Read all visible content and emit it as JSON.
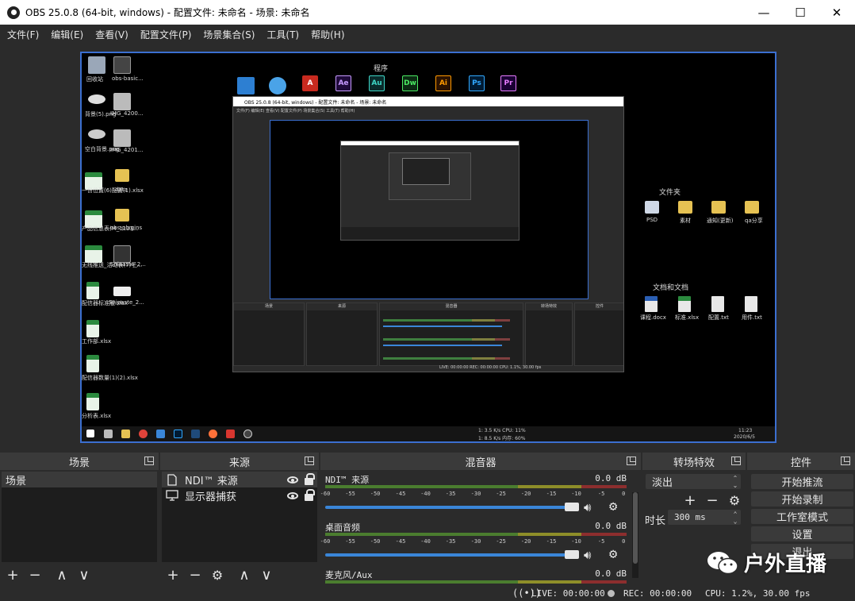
{
  "window": {
    "title": "OBS 25.0.8 (64-bit, windows) - 配置文件: 未命名 - 场景: 未命名",
    "minimize": "—",
    "maximize": "☐",
    "close": "✕"
  },
  "menu": [
    "文件(F)",
    "编辑(E)",
    "查看(V)",
    "配置文件(P)",
    "场景集合(S)",
    "工具(T)",
    "帮助(H)"
  ],
  "preview": {
    "desktop_header_programs": "程序",
    "desktop_header_folders": "文件夹",
    "desktop_header_docs": "文档和文档",
    "app_tiles": [
      "Ae",
      "Au",
      "Dw",
      "Ai",
      "Ps",
      "Pr"
    ],
    "left_icons": [
      "回收站",
      "obs-basic...",
      "背景(5).png",
      "IMG_4200...",
      "空白背景.png",
      "IMG_4201...",
      "一份位置(6)配置(1).xlsx",
      "data",
      "产品信息表(M_1123...",
      "obs-plugins",
      "无线推送_活动表(7)子...",
      "Snipaste_2...",
      "配信器标准版.xlsx",
      "Snipaste_2...",
      "工作部.xlsx",
      "配信器数量(1)(2).xlsx",
      "分析表.xlsx"
    ],
    "folder_labels": [
      "PSD",
      "素材",
      "通知(更新)",
      "qa分享"
    ],
    "doc_labels": [
      "课程.docx",
      "标准.xlsx",
      "配置.txt",
      "用件.txt"
    ],
    "nested_title": "OBS 25.0.8 (64-bit, windows) - 配置文件: 未命名 - 场景: 未命名",
    "nested_status": "LIVE: 00:00:00   REC: 00:00:00   CPU: 1.1%, 30.00 fps",
    "taskbar_clock": "11:23",
    "taskbar_date": "2020/6/5",
    "taskbar_net": "1: 3.5 K/s  CPU: 11%",
    "taskbar_net2": "1: 8.5 K/s  内存: 60%"
  },
  "scenes": {
    "header": "场景",
    "items": [
      "场景"
    ]
  },
  "sources": {
    "header": "来源",
    "items": [
      {
        "name": "NDI™ 来源",
        "icon": "file-icon"
      },
      {
        "name": "显示器捕获",
        "icon": "monitor-icon"
      }
    ]
  },
  "mixer": {
    "header": "混音器",
    "ticks": [
      "-60",
      "-55",
      "-50",
      "-45",
      "-40",
      "-35",
      "-30",
      "-25",
      "-20",
      "-15",
      "-10",
      "-5",
      "0"
    ],
    "channels": [
      {
        "name": "NDI™ 来源",
        "db": "0.0 dB",
        "volume": 1.0
      },
      {
        "name": "桌面音频",
        "db": "0.0 dB",
        "volume": 1.0
      },
      {
        "name": "麦克风/Aux",
        "db": "0.0 dB",
        "volume": 1.0
      }
    ]
  },
  "transitions": {
    "header": "转场特效",
    "selected": "淡出",
    "duration_label": "时长",
    "duration_value": "300 ms"
  },
  "controls": {
    "header": "控件",
    "buttons": [
      "开始推流",
      "开始录制",
      "工作室模式",
      "设置",
      "退出"
    ]
  },
  "status": {
    "live": "LIVE: 00:00:00",
    "rec": "REC: 00:00:00",
    "cpu": "CPU: 1.2%, 30.00 fps"
  },
  "watermark": "户外直播",
  "colors": {
    "accent": "#3b6fd0",
    "slider": "#3a86d8",
    "meter_green": "#4b7d2f",
    "meter_yellow": "#8e8e29",
    "meter_red": "#8d2e2e",
    "panel": "#2b2b2b",
    "list_bg": "#1d1d1d"
  }
}
